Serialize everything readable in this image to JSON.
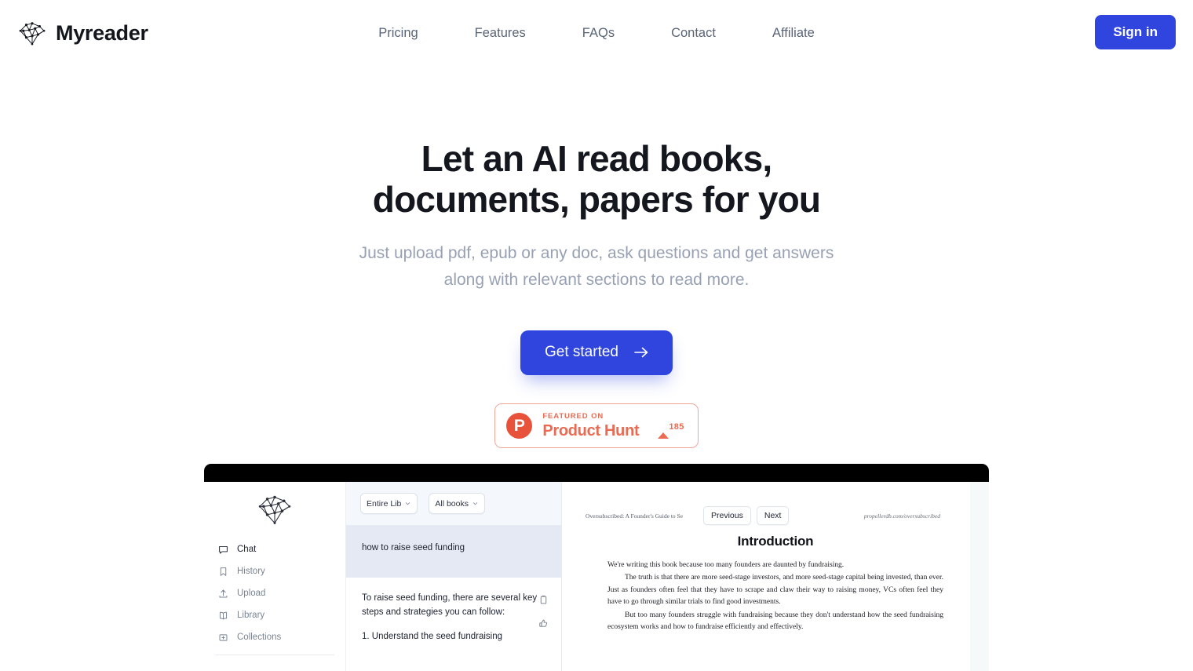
{
  "brand": {
    "name": "Myreader",
    "logo_icon": "network-graph-icon"
  },
  "nav": {
    "items": [
      {
        "label": "Pricing"
      },
      {
        "label": "Features"
      },
      {
        "label": "FAQs"
      },
      {
        "label": "Contact"
      },
      {
        "label": "Affiliate"
      }
    ],
    "signin_label": "Sign in"
  },
  "hero": {
    "title": "Let an AI read books, documents, papers for you",
    "subtitle": "Just upload pdf, epub or any doc, ask questions and get answers along with relevant sections to read more.",
    "cta_label": "Get started",
    "cta_icon": "arrow-right-icon"
  },
  "product_hunt": {
    "logo_letter": "P",
    "featured_label": "FEATURED ON",
    "name": "Product Hunt",
    "upvote_count": "185",
    "upvote_icon": "caret-up-icon"
  },
  "app": {
    "sidebar": {
      "logo_icon": "network-graph-icon",
      "items": [
        {
          "label": "Chat",
          "icon": "message-square-icon",
          "active": true
        },
        {
          "label": "History",
          "icon": "bookmark-icon",
          "active": false
        },
        {
          "label": "Upload",
          "icon": "upload-icon",
          "active": false
        },
        {
          "label": "Library",
          "icon": "book-open-icon",
          "active": false
        },
        {
          "label": "Collections",
          "icon": "folder-plus-icon",
          "active": false
        }
      ]
    },
    "chat": {
      "scope_dropdown": "Entire Lib",
      "books_dropdown": "All books",
      "query": "how to raise seed funding",
      "answer_intro": "To raise seed funding, there are several key steps and strategies you can follow:",
      "answer_item_1": "1. Understand the seed fundraising",
      "copy_icon": "clipboard-icon",
      "like_icon": "thumbs-up-icon"
    },
    "document": {
      "source_title": "Oversubscribed: A Founder's Guide to Se",
      "previous_label": "Previous",
      "next_label": "Next",
      "url": "propellerdb.com/oversubscribed",
      "heading": "Introduction",
      "paragraph_1": "We're writing this book because too many founders are daunted by fundraising.",
      "paragraph_2": "The truth is that there are more seed-stage investors, and more seed-stage capital being invested, than ever. Just as founders often feel that they have to scrape and claw their way to raising money, VCs often feel they have to go through similar trials to find good investments.",
      "paragraph_3": "But too many founders struggle with fundraising because they don't understand how the seed fundraising ecosystem works and how to fundraise efficiently and effectively."
    }
  },
  "colors": {
    "accent_blue": "#2f45dd",
    "product_hunt_red": "#ea6a52",
    "muted_text": "#98a1b3"
  }
}
